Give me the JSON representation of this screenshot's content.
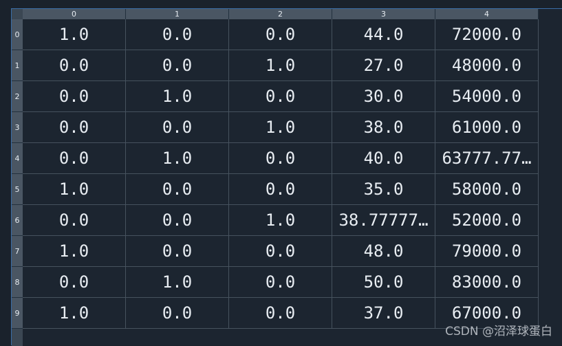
{
  "columns": [
    "0",
    "1",
    "2",
    "3",
    "4"
  ],
  "rows": [
    {
      "index": "0",
      "cells": [
        "1.0",
        "0.0",
        "0.0",
        "44.0",
        "72000.0"
      ]
    },
    {
      "index": "1",
      "cells": [
        "0.0",
        "0.0",
        "1.0",
        "27.0",
        "48000.0"
      ]
    },
    {
      "index": "2",
      "cells": [
        "0.0",
        "1.0",
        "0.0",
        "30.0",
        "54000.0"
      ]
    },
    {
      "index": "3",
      "cells": [
        "0.0",
        "0.0",
        "1.0",
        "38.0",
        "61000.0"
      ]
    },
    {
      "index": "4",
      "cells": [
        "0.0",
        "1.0",
        "0.0",
        "40.0",
        "63777.77…"
      ]
    },
    {
      "index": "5",
      "cells": [
        "1.0",
        "0.0",
        "0.0",
        "35.0",
        "58000.0"
      ]
    },
    {
      "index": "6",
      "cells": [
        "0.0",
        "0.0",
        "1.0",
        "38.77777…",
        "52000.0"
      ]
    },
    {
      "index": "7",
      "cells": [
        "1.0",
        "0.0",
        "0.0",
        "48.0",
        "79000.0"
      ]
    },
    {
      "index": "8",
      "cells": [
        "0.0",
        "1.0",
        "0.0",
        "50.0",
        "83000.0"
      ]
    },
    {
      "index": "9",
      "cells": [
        "1.0",
        "0.0",
        "0.0",
        "37.0",
        "67000.0"
      ]
    }
  ],
  "watermark": "CSDN @沼泽球蛋白",
  "colors": {
    "background": "#1c2530",
    "header": "#4a5663",
    "gridline": "#46525e",
    "text": "#e8edf2",
    "accent_border": "#3a6ea8"
  }
}
